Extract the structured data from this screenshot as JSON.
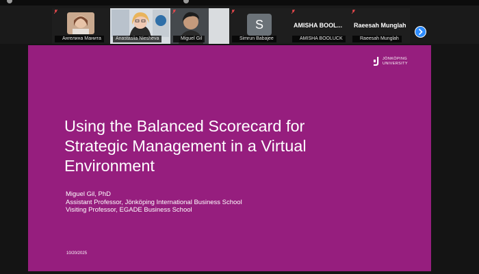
{
  "gallery": {
    "participants": [
      {
        "name": "Ангелина Манита",
        "muted": true
      },
      {
        "name": "Anastasiia Niesheva",
        "muted": false,
        "active_speaker": true
      },
      {
        "name": "Miguel Gil",
        "muted": true
      },
      {
        "name": "Simrun Babajee",
        "muted": true,
        "initial": "S"
      },
      {
        "name": "AMISHA BOOLUCK",
        "muted": true,
        "display_name": "AMISHA BOOL..."
      },
      {
        "name": "Raeesah Munglah",
        "muted": true,
        "display_name": "Raeesah Munglah"
      }
    ]
  },
  "slide": {
    "logo_line1": "JÖNKÖPING",
    "logo_line2": "UNIVERSITY",
    "title_lines": [
      "Using the Balanced Scorecard for",
      "Strategic Management in a Virtual",
      "Environment"
    ],
    "author_lines": [
      "Miguel Gil, PhD",
      "Assistant Professor, Jönköping International Business School",
      "Visiting Professor, EGADE Business School"
    ],
    "date": "10/20/2025"
  },
  "colors": {
    "slide_bg": "#961e7e",
    "active_border": "#2fd39a",
    "accent_blue": "#2d8cff",
    "muted_red": "#e5484d"
  }
}
